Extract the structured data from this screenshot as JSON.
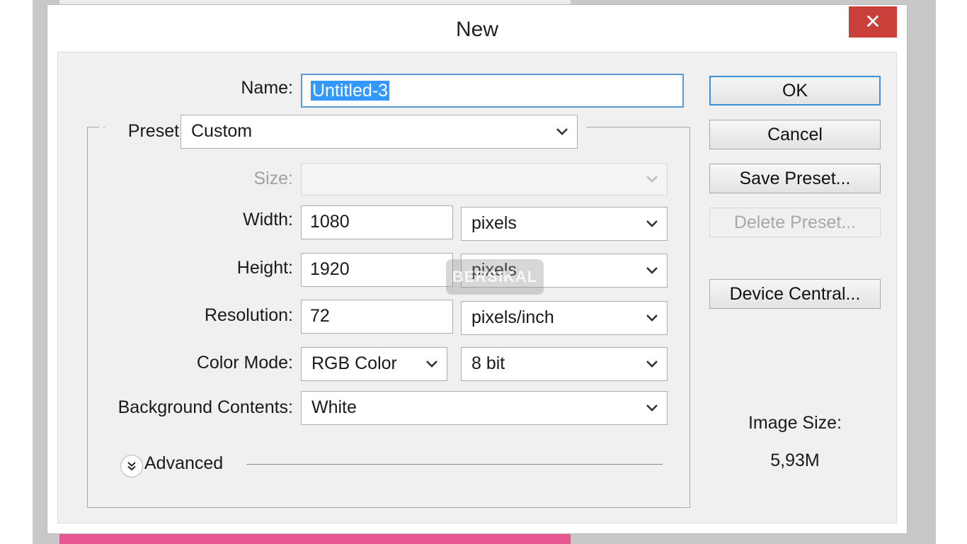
{
  "dialog": {
    "title": "New",
    "close_label": "✕"
  },
  "form": {
    "name_label": "Name:",
    "name_value": "Untitled-3",
    "preset_label": "Preset:",
    "preset_value": "Custom",
    "size_label": "Size:",
    "size_value": "",
    "width_label": "Width:",
    "width_value": "1080",
    "width_unit": "pixels",
    "height_label": "Height:",
    "height_value": "1920",
    "height_unit": "pixels",
    "resolution_label": "Resolution:",
    "resolution_value": "72",
    "resolution_unit": "pixels/inch",
    "color_mode_label": "Color Mode:",
    "color_mode_value": "RGB Color",
    "bit_depth_value": "8 bit",
    "background_label": "Background Contents:",
    "background_value": "White",
    "advanced_label": "Advanced"
  },
  "buttons": {
    "ok": "OK",
    "cancel": "Cancel",
    "save_preset": "Save Preset...",
    "delete_preset": "Delete Preset...",
    "device_central": "Device Central..."
  },
  "image_size": {
    "label": "Image Size:",
    "value": "5,93M"
  },
  "overlay": {
    "watermark": "BERSIKAL"
  },
  "icons": {
    "close": "close-icon",
    "dropdown": "chevron-down-icon",
    "advanced": "double-chevron-down-icon"
  },
  "colors": {
    "close_button": "#c9403b",
    "focus_border": "#5b9bd5",
    "selection": "#3399ff",
    "background_pink": "#e6588f"
  }
}
